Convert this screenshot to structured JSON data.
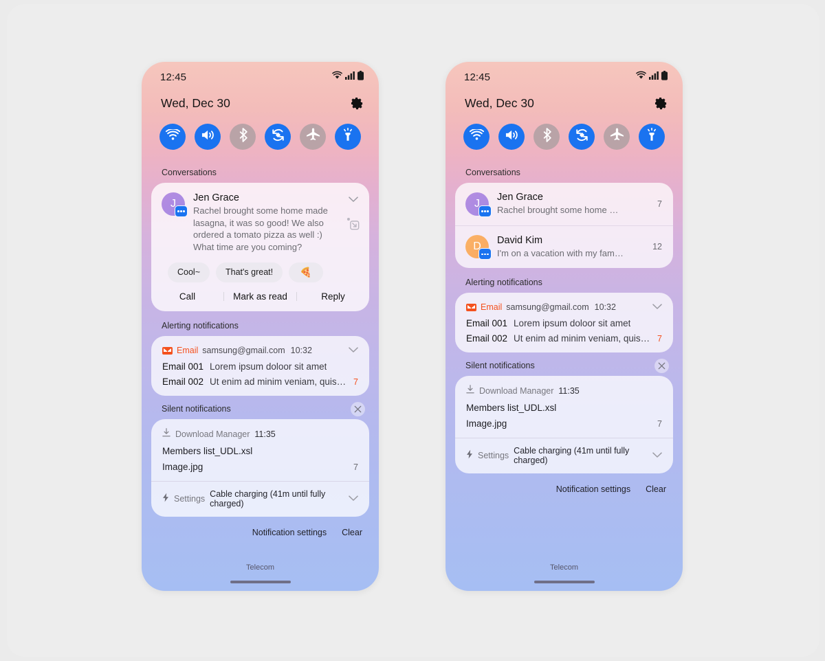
{
  "theme": {
    "canvas_bg": "#ebebeb",
    "accent_blue": "#1a73f0",
    "toggle_off": "#b9a3a7",
    "email_orange": "#f4511e",
    "gradient_top": "#f6c6bd",
    "gradient_bottom": "#a6bef3"
  },
  "status_bar": {
    "time": "12:45",
    "icons": [
      "wifi-icon",
      "signal-bars-icon",
      "battery-icon"
    ]
  },
  "header": {
    "date": "Wed, Dec 30",
    "settings_icon": "gear-icon"
  },
  "quick_toggles": [
    {
      "name": "wifi",
      "icon": "wifi-icon",
      "state": "on"
    },
    {
      "name": "sound",
      "icon": "sound-icon",
      "state": "on"
    },
    {
      "name": "bluetooth",
      "icon": "bluetooth-icon",
      "state": "off"
    },
    {
      "name": "auto-rotate",
      "icon": "auto-rotate-icon",
      "state": "on"
    },
    {
      "name": "airplane",
      "icon": "airplane-icon",
      "state": "off"
    },
    {
      "name": "flashlight",
      "icon": "flashlight-icon",
      "state": "on"
    }
  ],
  "sections": {
    "conversations": "Conversations",
    "alerting": "Alerting notifications",
    "silent": "Silent notifications",
    "silent_close_icon": "close-icon"
  },
  "conversation_expanded": {
    "avatar_initial": "J",
    "name": "Jen Grace",
    "message": "Rachel brought some home made lasagna, it was so good! We also ordered a tomato pizza as well :) What time are you coming?",
    "expand_icon": "chevron-down-icon",
    "popout_icon": "bubble-popout-icon",
    "quick_replies": [
      "Cool~",
      "That's great!",
      "🍕"
    ],
    "actions": [
      "Call",
      "Mark as read",
      "Reply"
    ]
  },
  "conversation_list": [
    {
      "avatar_initial": "J",
      "name": "Jen Grace",
      "message": "Rachel brought some home made la...",
      "count": "7"
    },
    {
      "avatar_initial": "D",
      "name": "David Kim",
      "message": "I'm on a vacation with my family now.",
      "count": "12"
    }
  ],
  "email_card": {
    "app": "Email",
    "account": "samsung@gmail.com",
    "time": "10:32",
    "expand_icon": "chevron-down-icon",
    "rows": [
      {
        "subject": "Email 001",
        "preview": "Lorem ipsum doloor sit amet",
        "count": ""
      },
      {
        "subject": "Email 002",
        "preview": "Ut enim ad minim veniam, quis n...",
        "count": "7"
      }
    ]
  },
  "download_card": {
    "app": "Download Manager",
    "app_icon": "download-icon",
    "time": "11:35",
    "files": [
      {
        "name": "Members list_UDL.xsl",
        "count": ""
      },
      {
        "name": "Image.jpg",
        "count": "7"
      }
    ]
  },
  "settings_card": {
    "app_icon": "bolt-icon",
    "app": "Settings",
    "text": "Cable charging (41m until fully charged)",
    "expand_icon": "chevron-down-icon"
  },
  "footer": {
    "notification_settings": "Notification settings",
    "clear": "Clear",
    "carrier": "Telecom"
  }
}
